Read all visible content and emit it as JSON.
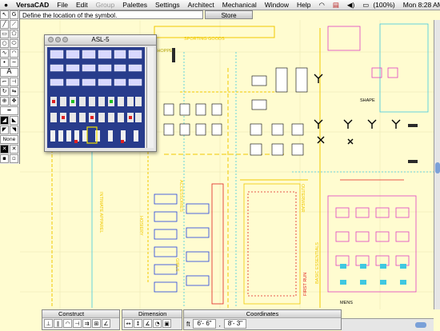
{
  "menubar": {
    "app_name": "VersaCAD",
    "items": [
      "File",
      "Edit",
      "Group",
      "Palettes",
      "Settings",
      "Architect",
      "Mechanical",
      "Window",
      "Help"
    ],
    "battery": "(100%)",
    "clock": "Mon 8:28 AM"
  },
  "prompt": {
    "text": "Define the location of the symbol."
  },
  "store_tab": {
    "label": "Store"
  },
  "symbol_window": {
    "title": "ASL-5"
  },
  "drawing_labels": {
    "sporting_goods": "SPORTING GOODS",
    "outerwear": "OUTERWEAR",
    "first_run": "FIRST RUN",
    "basic_essentials": "BASIC ESSENTIALS",
    "mens": "MENS",
    "intimate_apparel": "INTIMATE APPAREL",
    "hosiery": "HOSIERY",
    "accessories": "ACCESSORIES",
    "girls": "GIRLS",
    "jr_shoppe": "JR. SHOPPE",
    "shape": "SHAPE"
  },
  "palettes": {
    "construct": "Construct",
    "dimension": "Dimension",
    "coordinates": "Coordinates"
  },
  "coordinates": {
    "unit": "ft",
    "x": "6'- 6\"",
    "y": "8'- 3\""
  },
  "toolbox": {
    "g_label": "G",
    "text_tool": "A",
    "none_label": "None"
  },
  "colors": {
    "drawing_bg": "#fffcd0",
    "symbol_bg": "#283c8c",
    "cad_yellow": "#f0c800",
    "cad_cyan": "#40c8e0",
    "cad_magenta": "#e040c0",
    "cad_blue": "#2040e0",
    "cad_red": "#e02020"
  }
}
